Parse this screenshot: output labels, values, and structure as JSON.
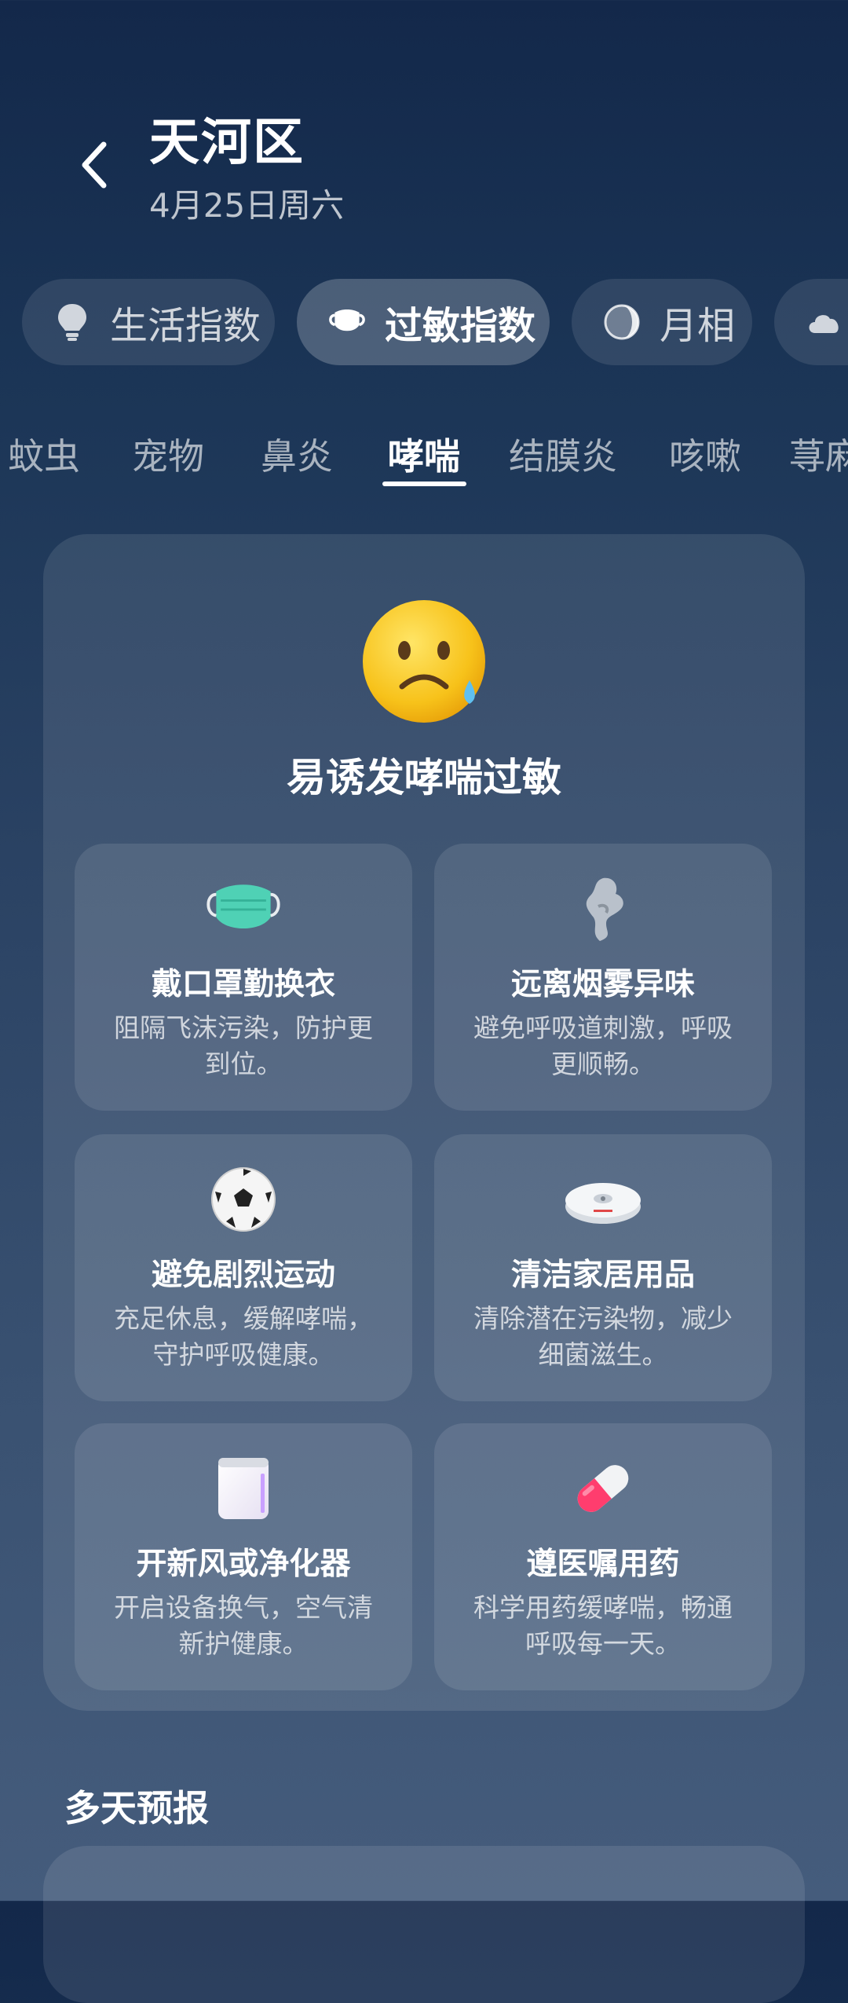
{
  "header": {
    "title": "天河区",
    "date": "4月25日周六"
  },
  "category_tabs": [
    {
      "label": "生活指数",
      "icon": "lightbulb-icon",
      "active": false
    },
    {
      "label": "过敏指数",
      "icon": "mask-icon",
      "active": true
    },
    {
      "label": "月相",
      "icon": "moon-phase-icon",
      "active": false
    },
    {
      "label": "",
      "icon": "cloud-icon",
      "active": false
    }
  ],
  "sub_tabs": [
    {
      "label": "蚊虫"
    },
    {
      "label": "宠物"
    },
    {
      "label": "鼻炎"
    },
    {
      "label": "哮喘",
      "active": true
    },
    {
      "label": "结膜炎"
    },
    {
      "label": "咳嗽"
    },
    {
      "label": "荨麻"
    }
  ],
  "status": {
    "icon": "sad-face-icon",
    "level_text": "易诱发哮喘过敏"
  },
  "tips": [
    {
      "icon": "face-mask-icon",
      "title": "戴口罩勤换衣",
      "desc": "阻隔飞沫污染，防护更到位。"
    },
    {
      "icon": "smoke-icon",
      "title": "远离烟雾异味",
      "desc": "避免呼吸道刺激，呼吸更顺畅。"
    },
    {
      "icon": "soccer-ball-icon",
      "title": "避免剧烈运动",
      "desc": "充足休息，缓解哮喘，守护呼吸健康。"
    },
    {
      "icon": "robot-vacuum-icon",
      "title": "清洁家居用品",
      "desc": "清除潜在污染物，减少细菌滋生。"
    },
    {
      "icon": "air-purifier-icon",
      "title": "开新风或净化器",
      "desc": "开启设备换气，空气清新护健康。"
    },
    {
      "icon": "pill-icon",
      "title": "遵医嘱用药",
      "desc": "科学用药缓哮喘，畅通呼吸每一天。"
    }
  ],
  "forecast": {
    "title": "多天预报"
  },
  "colors": {
    "bg_top": "#13284a",
    "bg_bottom": "#455c7c",
    "card_overlay": "rgba(255,255,255,0.1)"
  }
}
